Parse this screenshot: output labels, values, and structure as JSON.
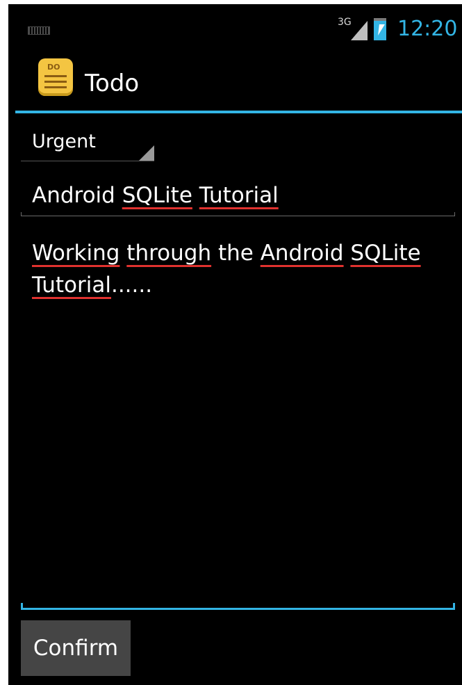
{
  "status_bar": {
    "network_type": "3G",
    "time": "12:20",
    "icons": [
      "keyboard-icon",
      "signal-icon",
      "battery-charging-icon"
    ],
    "accent_color": "#33b5e5"
  },
  "action_bar": {
    "title": "Todo",
    "icon_text": "DO",
    "icon_name": "todo-app-icon"
  },
  "form": {
    "category_selected": "Urgent",
    "summary_value": [
      "Android ",
      "SQLite",
      " ",
      "Tutorial"
    ],
    "description_value": [
      "Working",
      " ",
      "through",
      " the ",
      "Android",
      " ",
      "SQLite",
      " ",
      "Tutorial",
      "......"
    ],
    "confirm_label": "Confirm"
  },
  "colors": {
    "background": "#000000",
    "accent": "#33b5e5",
    "spellcheck": "#e0322f",
    "button": "#454545"
  }
}
